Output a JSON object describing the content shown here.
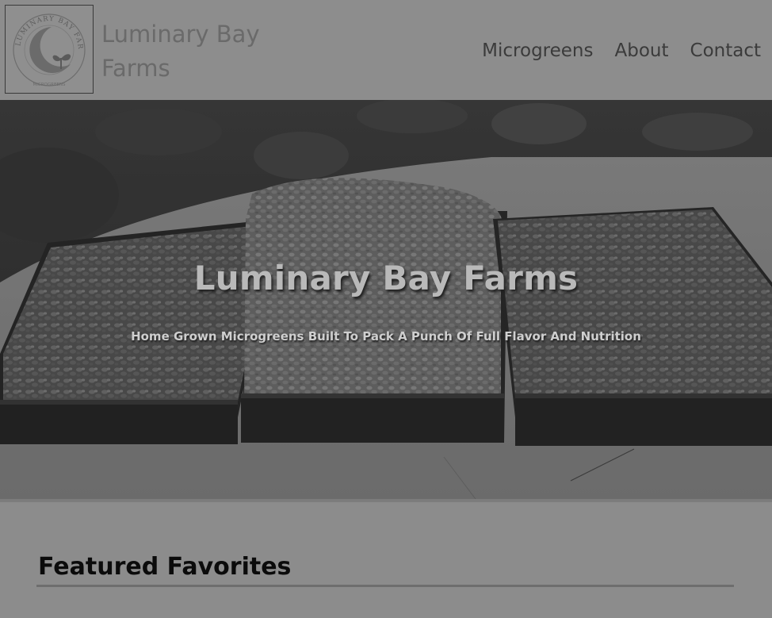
{
  "header": {
    "logo_alt": "Luminary Bay Farms logo",
    "logo_ring_text": "LUMINARY BAY FARMS",
    "logo_small_text": "MICROGREENS",
    "brand_name": "Luminary Bay Farms"
  },
  "nav": {
    "items": [
      {
        "label": "Microgreens"
      },
      {
        "label": "About"
      },
      {
        "label": "Contact"
      }
    ]
  },
  "hero": {
    "title": "Luminary Bay Farms",
    "subtitle": "Home Grown Microgreens Built To Pack A Punch Of Full Flavor And Nutrition"
  },
  "featured": {
    "title": "Featured Favorites"
  },
  "colors": {
    "overlay": "#8a8a8a",
    "heading": "#0b0b0b"
  }
}
